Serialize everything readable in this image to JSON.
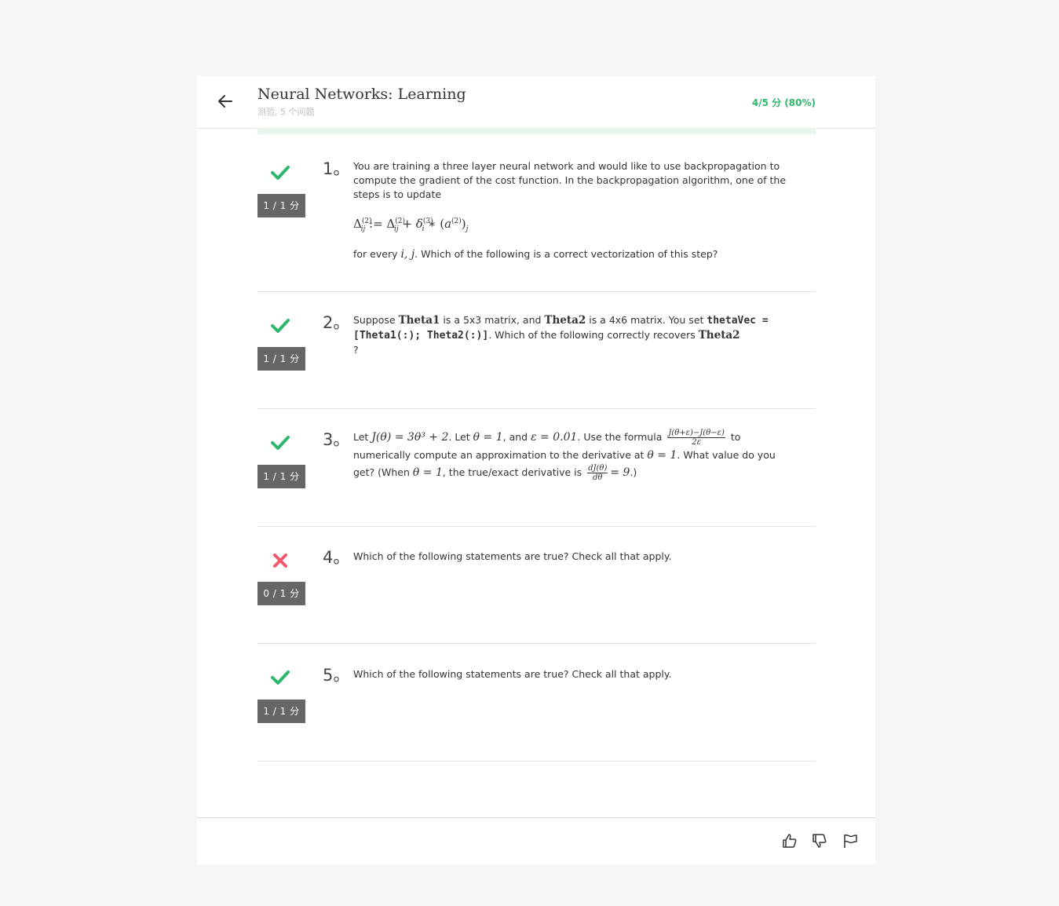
{
  "header": {
    "title": "Neural Networks: Learning",
    "subtitle": "测验, 5 个问题",
    "score": "4/5 分 (80%)"
  },
  "colors": {
    "correct": "#2eb66b",
    "incorrect": "#f05a6e",
    "points_bg": "#666666"
  },
  "questions": [
    {
      "number": "1。",
      "status": "correct",
      "points": "1 / 1 分",
      "text_intro": "You are training a three layer neural network and would like to use backpropagation to compute the gradient of the cost function. In the backpropagation algorithm, one of the steps is to update",
      "formula": "Δ(2)ij := Δ(2)ij + δ(3)i ∗ (a(2))j",
      "text_a": "for every ",
      "math_ij": "i, j",
      "text_b": ". Which of the following is a correct vectorization of this step?"
    },
    {
      "number": "2。",
      "status": "correct",
      "points": "1 / 1 分",
      "text_a": "Suppose ",
      "theta1": "Theta1",
      "text_b": " is a 5x3 matrix, and ",
      "theta2": "Theta2",
      "text_c": " is a 4x6 matrix. You set ",
      "code": "thetaVec = [Theta1(:); Theta2(:)]",
      "text_d": ". Which of the following correctly recovers ",
      "theta2_b": "Theta2",
      "text_e": "?"
    },
    {
      "number": "3。",
      "status": "correct",
      "points": "1 / 1 分",
      "text_a": "Let ",
      "math_j": "J(θ) = 3θ³ + 2",
      "text_b": ". Let ",
      "math_theta": "θ = 1",
      "text_c": ", and ",
      "math_eps": "ε = 0.01",
      "text_d": ". Use the formula ",
      "frac_num": "J(θ+ε)−J(θ−ε)",
      "frac_den": "2ε",
      "text_e": " to numerically compute an approximation to the derivative at ",
      "math_theta2": "θ = 1",
      "text_f": ". What value do you get? (When ",
      "math_theta3": "θ = 1",
      "text_g": ", the true/exact derivative is ",
      "dfrac_num": "dJ(θ)",
      "dfrac_den": "dθ",
      "math_eq": "= 9",
      "text_h": ".)"
    },
    {
      "number": "4。",
      "status": "incorrect",
      "points": "0 / 1 分",
      "text": "Which of the following statements are true? Check all that apply."
    },
    {
      "number": "5。",
      "status": "correct",
      "points": "1 / 1 分",
      "text": "Which of the following statements are true? Check all that apply."
    }
  ],
  "footer": {
    "icons": [
      "thumbs-up-icon",
      "thumbs-down-icon",
      "flag-icon"
    ]
  }
}
